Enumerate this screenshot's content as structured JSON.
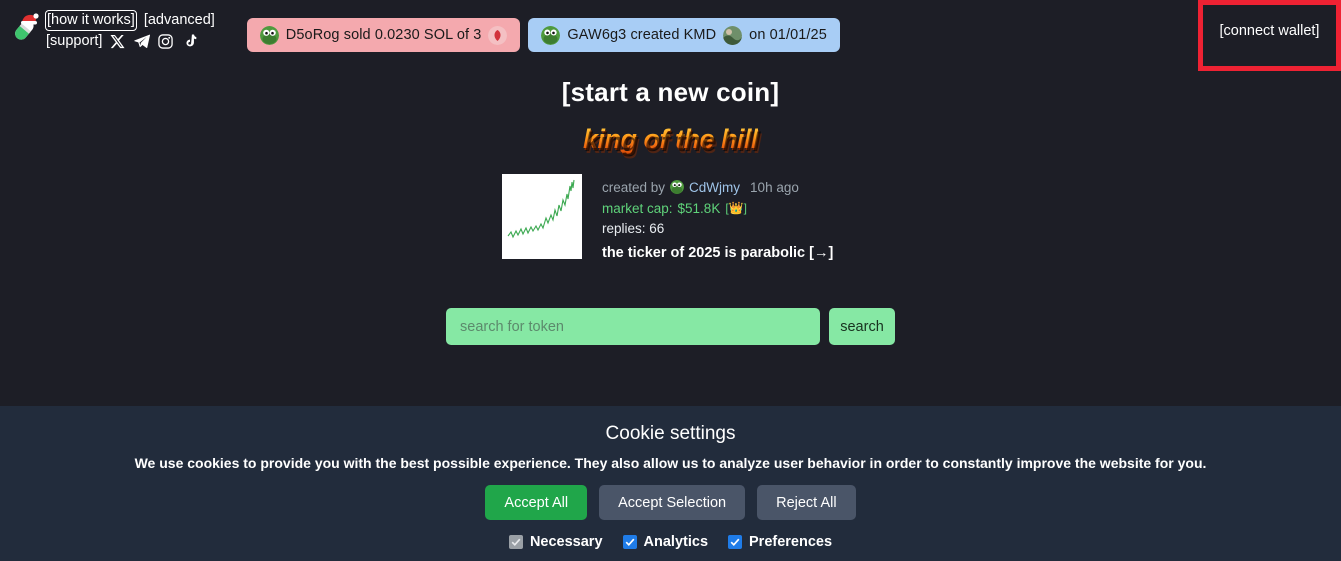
{
  "header": {
    "logo_icon": "pill-santa-hat-logo",
    "nav": [
      {
        "label": "[how it works]",
        "name": "how-it-works-link",
        "focused": true
      },
      {
        "label": "[advanced]",
        "name": "advanced-link",
        "focused": false
      },
      {
        "label": "[support]",
        "name": "support-link",
        "focused": false
      }
    ],
    "socials": [
      {
        "name": "x-twitter-icon"
      },
      {
        "name": "telegram-icon"
      },
      {
        "name": "instagram-icon"
      },
      {
        "name": "tiktok-icon"
      }
    ],
    "wallet_button": "[connect wallet]",
    "annotation_color": "#ee2233"
  },
  "ticker": [
    {
      "text": "D5oRog  sold 0.0230 SOL of 3",
      "color": "#f4a9ae",
      "avatar": "pepe-avatar",
      "trailing_icon": "token-thumbnail"
    },
    {
      "text_before": "GAW6g3 created KMD",
      "text_after": "on 01/01/25",
      "color": "#a8cdf5",
      "avatar": "pepe-avatar",
      "mid_icon": "token-thumbnail"
    }
  ],
  "main": {
    "start_coin": "[start a new coin]",
    "king_of_the_hill": "king of the hill",
    "coin": {
      "created_by_label": "created by",
      "creator": "CdWjmy",
      "age": "10h ago",
      "market_cap_label": "market cap:",
      "market_cap_value": "$51.8K",
      "crown": "[👑]",
      "replies": "replies: 66",
      "description": "the ticker of 2025 is parabolic [→]",
      "thumbnail_icon": "green-parabolic-chart"
    }
  },
  "search": {
    "placeholder": "search for token",
    "value": "",
    "button": "search",
    "accent": "#86e8a4"
  },
  "cookie": {
    "title": "Cookie settings",
    "body": "We use cookies to provide you with the best possible experience. They also allow us to analyze user behavior in order to constantly improve the website for you.",
    "buttons": [
      {
        "label": "Accept All",
        "style": "green"
      },
      {
        "label": "Accept Selection",
        "style": "grey"
      },
      {
        "label": "Reject All",
        "style": "grey"
      }
    ],
    "checkboxes": [
      {
        "label": "Necessary",
        "checked": true,
        "disabled": true
      },
      {
        "label": "Analytics",
        "checked": true,
        "disabled": false
      },
      {
        "label": "Preferences",
        "checked": true,
        "disabled": false
      }
    ]
  }
}
